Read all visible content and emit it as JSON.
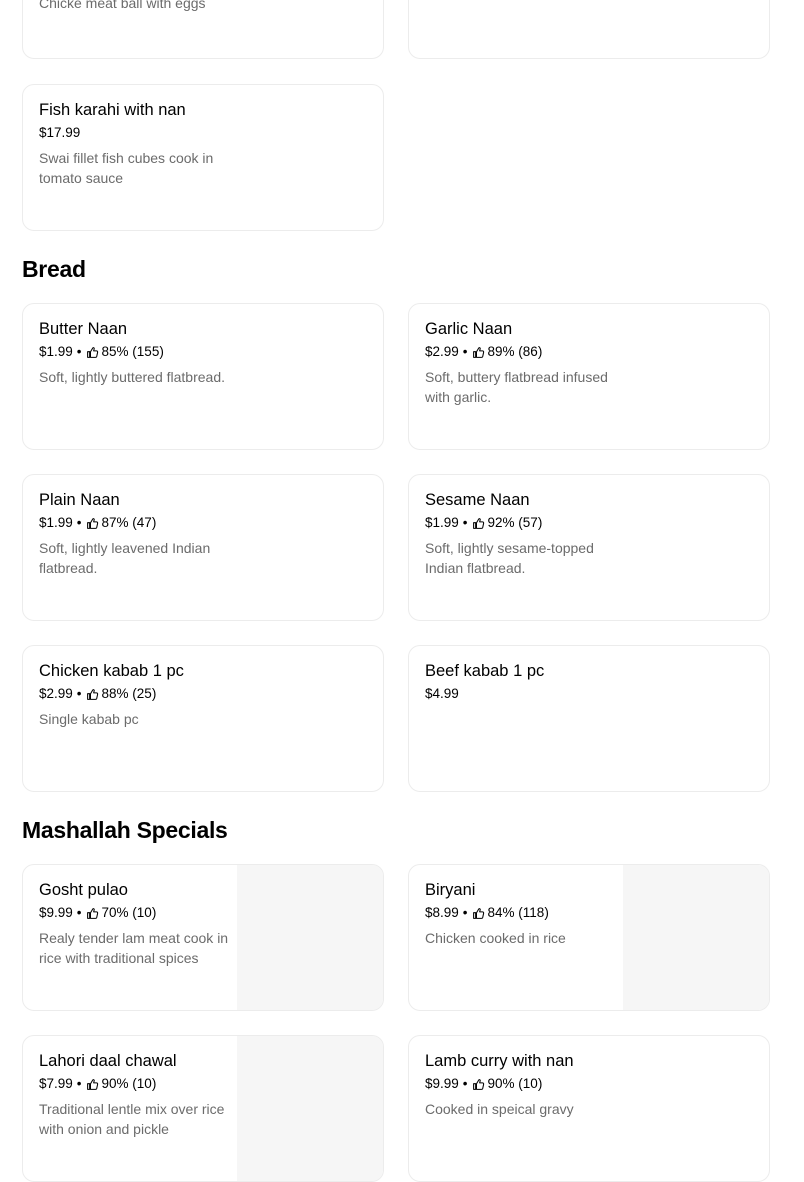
{
  "top_cards": [
    {
      "desc": "Chicke meat ball with eggs"
    }
  ],
  "fish": {
    "name": "Fish karahi with nan",
    "price": "$17.99",
    "desc": "Swai fillet fish cubes cook in tomato sauce"
  },
  "sections": {
    "bread": {
      "title": "Bread"
    },
    "specials": {
      "title": "Mashallah Specials"
    }
  },
  "bread_items": [
    {
      "name": "Butter Naan",
      "price": "$1.99",
      "rating": "85% (155)",
      "desc": "Soft, lightly buttered flatbread."
    },
    {
      "name": "Garlic Naan",
      "price": "$2.99",
      "rating": "89% (86)",
      "desc": "Soft, buttery flatbread infused with garlic."
    },
    {
      "name": "Plain Naan",
      "price": "$1.99",
      "rating": "87% (47)",
      "desc": "Soft, lightly leavened Indian flatbread."
    },
    {
      "name": "Sesame Naan",
      "price": "$1.99",
      "rating": "92% (57)",
      "desc": "Soft, lightly sesame-topped Indian flatbread."
    },
    {
      "name": "Chicken kabab 1 pc",
      "price": "$2.99",
      "rating": "88% (25)",
      "desc": "Single kabab pc"
    },
    {
      "name": "Beef kabab 1 pc",
      "price": "$4.99"
    }
  ],
  "special_items": [
    {
      "name": "Gosht pulao",
      "price": "$9.99",
      "rating": "70% (10)",
      "desc": "Realy tender lam meat cook in rice with traditional spices"
    },
    {
      "name": "Biryani",
      "price": "$8.99",
      "rating": "84% (118)",
      "desc": "Chicken cooked in rice"
    },
    {
      "name": "Lahori daal chawal",
      "price": "$7.99",
      "rating": "90% (10)",
      "desc": "Traditional lentle mix over rice with onion and pickle"
    },
    {
      "name": "Lamb curry with nan",
      "price": "$9.99",
      "rating": "90% (10)",
      "desc": "Cooked in speical gravy"
    }
  ],
  "icons": {
    "rating": "thumbs-up-icon"
  },
  "colors": {
    "text": "#000000",
    "muted": "#6b6b6b",
    "border": "#ececec",
    "image_placeholder": "#f6f6f6"
  }
}
